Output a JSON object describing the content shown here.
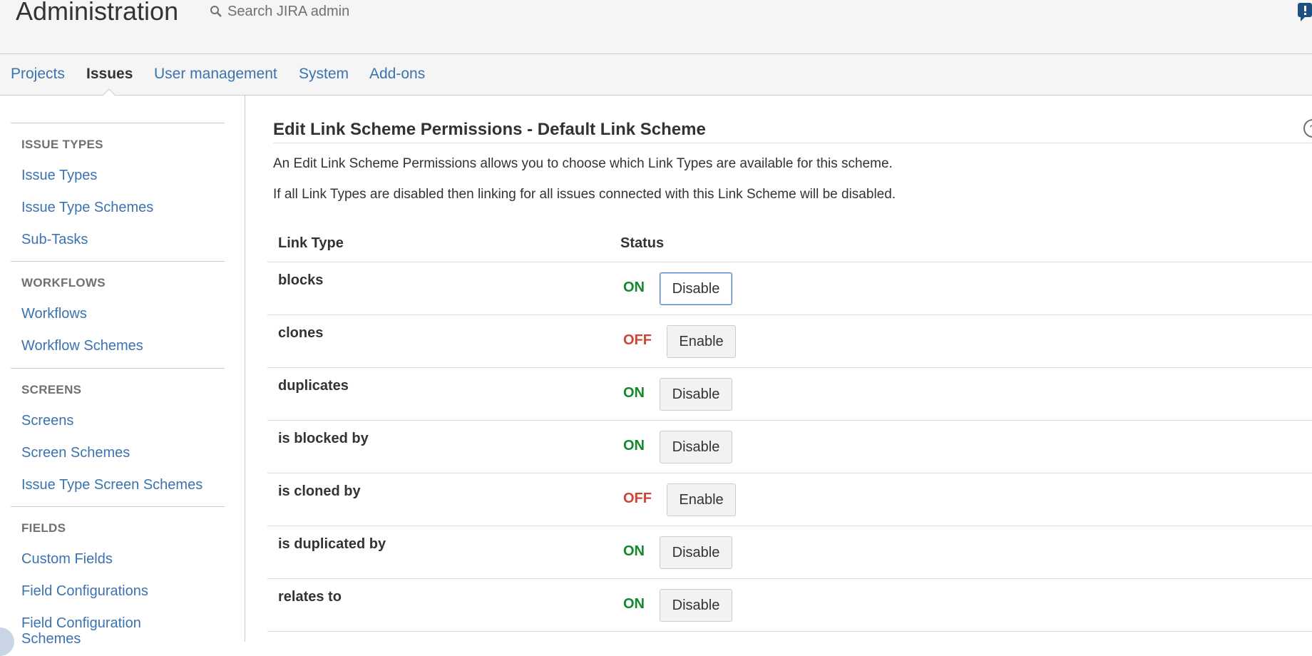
{
  "header": {
    "title": "Administration",
    "search_placeholder": "Search JIRA admin"
  },
  "nav": {
    "tabs": [
      {
        "label": "Projects",
        "active": false
      },
      {
        "label": "Issues",
        "active": true
      },
      {
        "label": "User management",
        "active": false
      },
      {
        "label": "System",
        "active": false
      },
      {
        "label": "Add-ons",
        "active": false
      }
    ]
  },
  "sidebar": {
    "sections": [
      {
        "heading": "ISSUE TYPES",
        "items": [
          "Issue Types",
          "Issue Type Schemes",
          "Sub-Tasks"
        ]
      },
      {
        "heading": "WORKFLOWS",
        "items": [
          "Workflows",
          "Workflow Schemes"
        ]
      },
      {
        "heading": "SCREENS",
        "items": [
          "Screens",
          "Screen Schemes",
          "Issue Type Screen Schemes"
        ]
      },
      {
        "heading": "FIELDS",
        "items": [
          "Custom Fields",
          "Field Configurations",
          "Field Configuration Schemes"
        ]
      }
    ]
  },
  "main": {
    "title": "Edit Link Scheme Permissions - Default Link Scheme",
    "description_1": "An Edit Link Scheme Permissions allows you to choose which Link Types are available for this scheme.",
    "description_2": "If all Link Types are disabled then linking for all issues connected with this Link Scheme will be disabled.",
    "table": {
      "headers": {
        "link_type": "Link Type",
        "status": "Status"
      },
      "rows": [
        {
          "name": "blocks",
          "status": "ON",
          "action": "Disable"
        },
        {
          "name": "clones",
          "status": "OFF",
          "action": "Enable"
        },
        {
          "name": "duplicates",
          "status": "ON",
          "action": "Disable"
        },
        {
          "name": "is blocked by",
          "status": "ON",
          "action": "Disable"
        },
        {
          "name": "is cloned by",
          "status": "OFF",
          "action": "Enable"
        },
        {
          "name": "is duplicated by",
          "status": "ON",
          "action": "Disable"
        },
        {
          "name": "relates to",
          "status": "ON",
          "action": "Disable"
        }
      ]
    }
  },
  "colors": {
    "link": "#3b73af",
    "status_on": "#14892c",
    "status_off": "#d04437",
    "header_bg": "#f5f5f5"
  }
}
